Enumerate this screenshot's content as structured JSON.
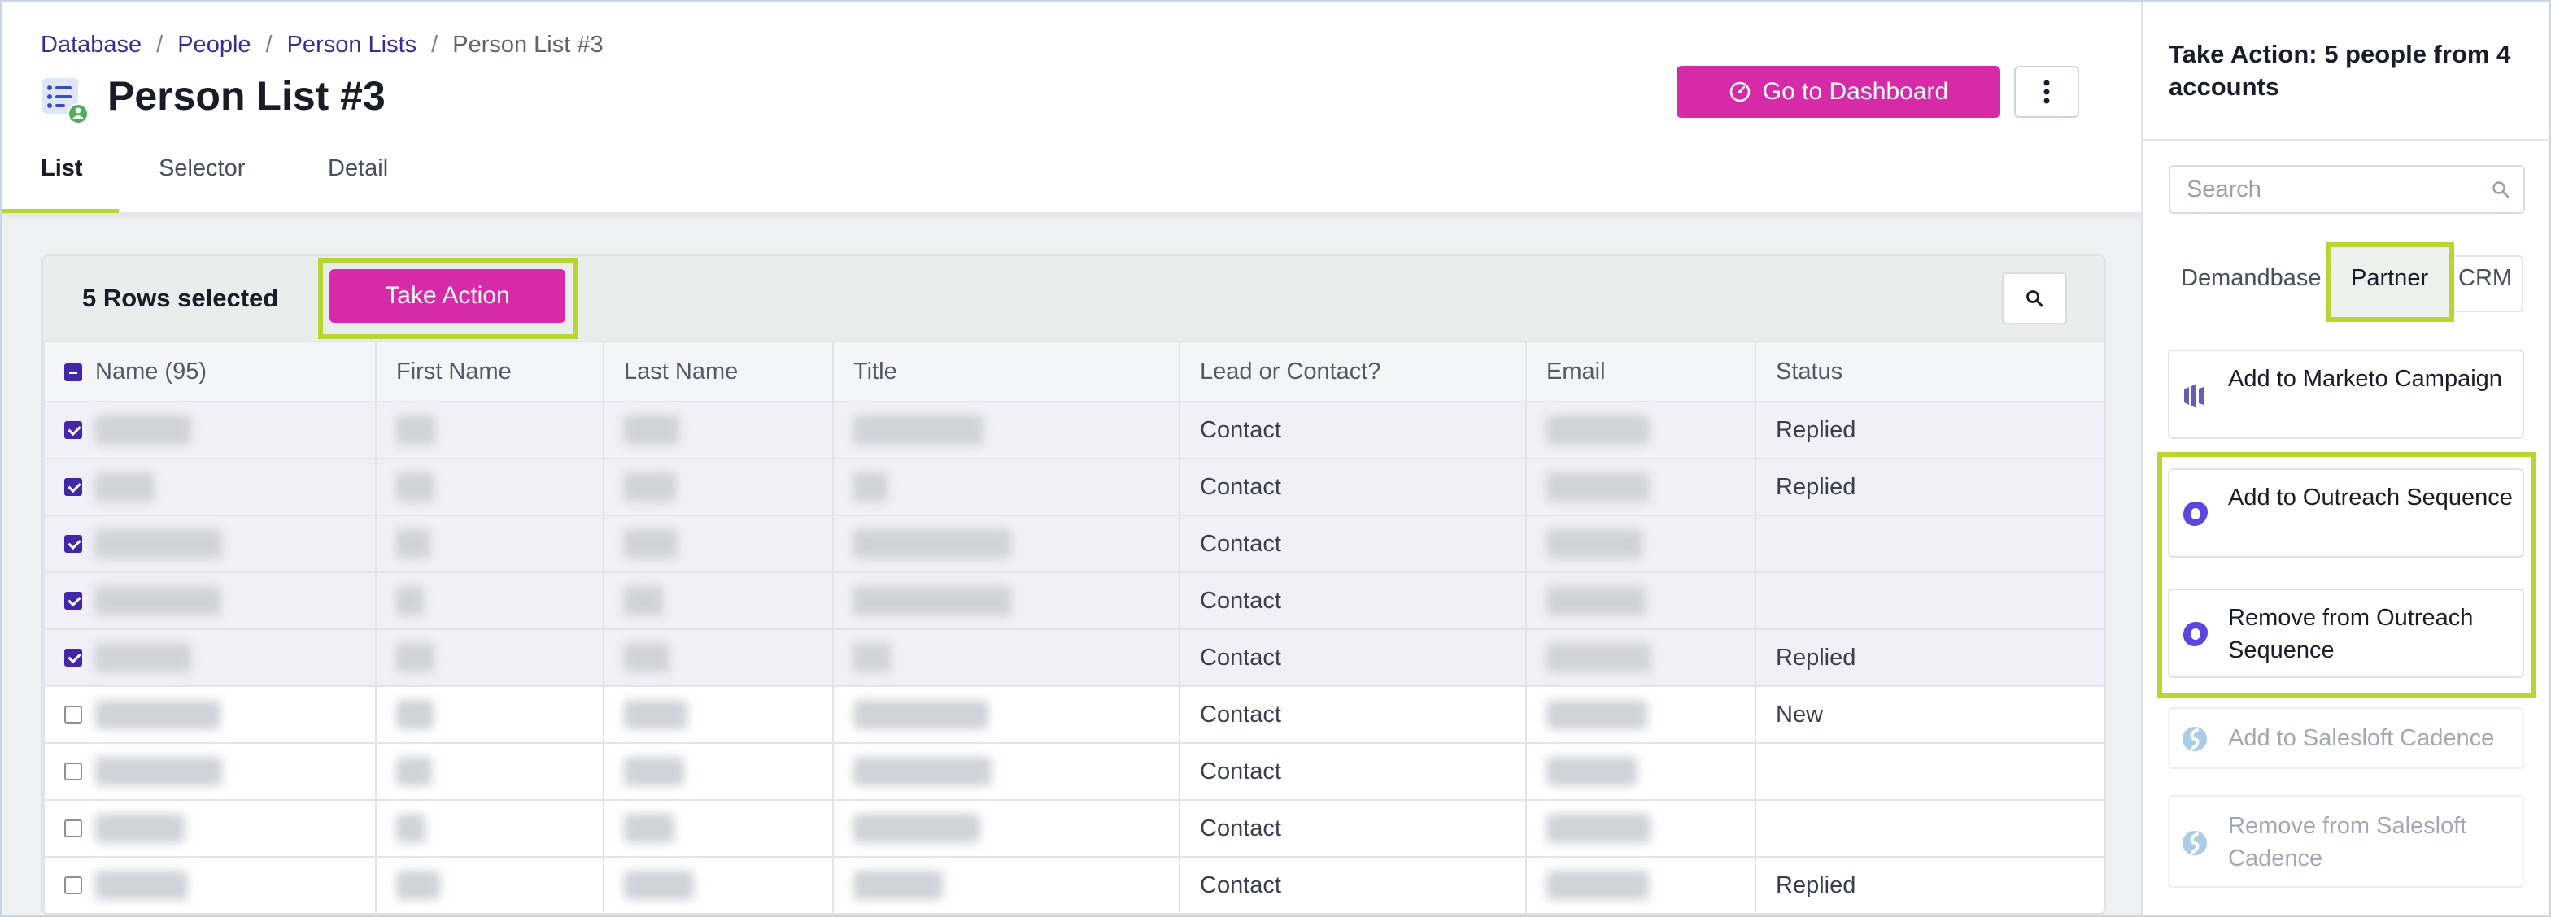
{
  "breadcrumb": {
    "items": [
      "Database",
      "People",
      "Person Lists"
    ],
    "current": "Person List #3"
  },
  "page": {
    "title": "Person List #3"
  },
  "header": {
    "dashboard_button": "Go to Dashboard",
    "more_icon": "vertical-ellipsis-icon"
  },
  "tabs": [
    "List",
    "Selector",
    "Detail"
  ],
  "toolbar": {
    "rows_selected": "5 Rows selected",
    "take_action": "Take Action"
  },
  "table": {
    "columns": [
      "Name (95)",
      "First Name",
      "Last Name",
      "Title",
      "Lead or Contact?",
      "Email",
      "Status"
    ],
    "rows": [
      {
        "selected": true,
        "lead_or_contact": "Contact",
        "status": "Replied"
      },
      {
        "selected": true,
        "lead_or_contact": "Contact",
        "status": "Replied"
      },
      {
        "selected": true,
        "lead_or_contact": "Contact",
        "status": ""
      },
      {
        "selected": true,
        "lead_or_contact": "Contact",
        "status": ""
      },
      {
        "selected": true,
        "lead_or_contact": "Contact",
        "status": "Replied"
      },
      {
        "selected": false,
        "lead_or_contact": "Contact",
        "status": "New"
      },
      {
        "selected": false,
        "lead_or_contact": "Contact",
        "status": ""
      },
      {
        "selected": false,
        "lead_or_contact": "Contact",
        "status": ""
      },
      {
        "selected": false,
        "lead_or_contact": "Contact",
        "status": "Replied"
      }
    ]
  },
  "panel": {
    "title": "Take Action: 5 people from 4 accounts",
    "search_placeholder": "Search",
    "tabs": [
      "Demandbase",
      "Partner",
      "CRM"
    ],
    "actions": [
      {
        "label": "Add to Marketo Campaign",
        "icon": "marketo-icon",
        "enabled": true
      },
      {
        "label": "Add to Outreach Sequence",
        "icon": "outreach-icon",
        "enabled": true
      },
      {
        "label": "Remove from Outreach Sequence",
        "icon": "outreach-icon",
        "enabled": true
      },
      {
        "label": "Add to Salesloft Cadence",
        "icon": "salesloft-icon",
        "enabled": false
      },
      {
        "label": "Remove from Salesloft Cadence",
        "icon": "salesloft-icon",
        "enabled": false
      }
    ]
  },
  "colors": {
    "brand_magenta": "#d62aa9",
    "highlight_lime": "#b8d531",
    "link_purple": "#3b2b9b",
    "checkbox_purple": "#4426a8"
  }
}
